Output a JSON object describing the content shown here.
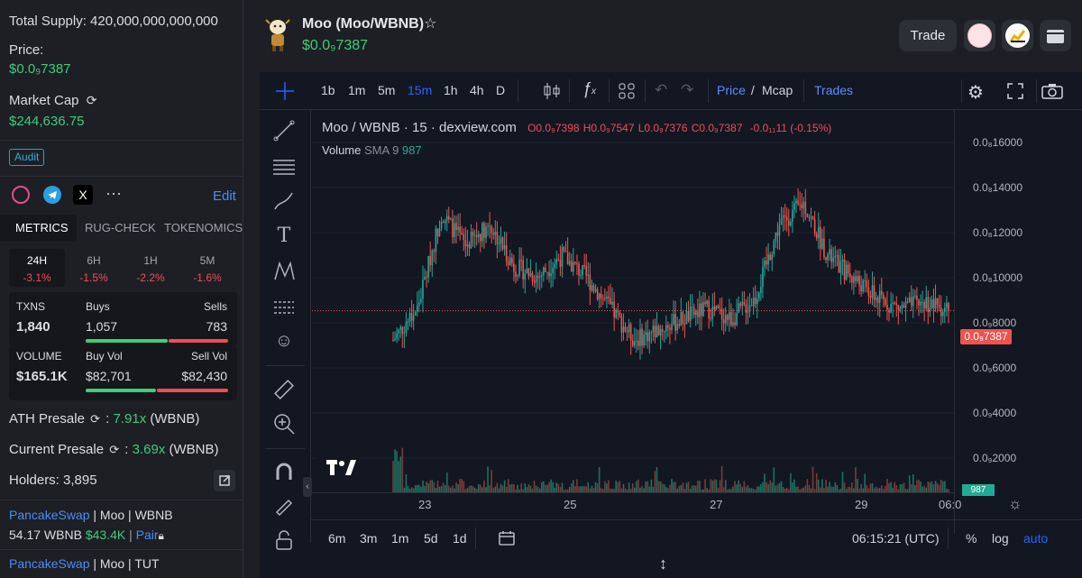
{
  "left": {
    "total_supply": "Total Supply: 420,000,000,000,000",
    "price_label": "Price:",
    "price_value": "$0.0₉7387",
    "mcap_label": "Market Cap",
    "mcap_value": "$244,636.75",
    "audit": "Audit",
    "edit": "Edit",
    "more": "···",
    "tabs": [
      "METRICS",
      "RUG-CHECK",
      "TOKENOMICS"
    ],
    "timeframes": [
      {
        "label": "24H",
        "change": "-3.1%"
      },
      {
        "label": "6H",
        "change": "-1.5%"
      },
      {
        "label": "1H",
        "change": "-2.2%"
      },
      {
        "label": "5M",
        "change": "-1.6%"
      }
    ],
    "txns": {
      "label": "TXNS",
      "value": "1,840",
      "buys_label": "Buys",
      "buys": "1,057",
      "sells_label": "Sells",
      "sells": "783"
    },
    "volume": {
      "label": "VOLUME",
      "value": "$165.1K",
      "buyvol_label": "Buy Vol",
      "buyvol": "$82,701",
      "sellvol_label": "Sell Vol",
      "sellvol": "$82,430"
    },
    "ath_label": "ATH Presale",
    "ath_sep": ":",
    "ath_value": "7.91x",
    "ath_unit": "(WBNB)",
    "cur_label": "Current Presale",
    "cur_sep": ":",
    "cur_value": "3.69x",
    "cur_unit": "(WBNB)",
    "holders": "Holders: 3,895",
    "pair1_dex": "PancakeSwap",
    "pair1_rest": " | Moo | WBNB",
    "pair1_amount": "54.17 WBNB",
    "pair1_usd": "$43.4K",
    "pair1_link": "Pair",
    "pair2_dex": "PancakeSwap",
    "pair2_rest": " | Moo | TUT"
  },
  "header": {
    "title": "Moo (Moo/WBNB)",
    "star": "☆",
    "price": "$0.0₉7387",
    "trade": "Trade"
  },
  "chart": {
    "intervals": [
      "1b",
      "1m",
      "5m",
      "15m",
      "1h",
      "4h",
      "D"
    ],
    "active_interval": "15m",
    "price_label": "Price",
    "slash": " / ",
    "mcap_label": "Mcap",
    "trades_label": "Trades",
    "legend_pair": "Moo / WBNB · 15 · dexview.com",
    "o": "O0.0₉7398",
    "h": "H0.0₉7547",
    "l": "L0.0₉7376",
    "c": "C0.0₉7387",
    "chg": "-0.0₁₁11 (-0.15%)",
    "vol_label": "Volume",
    "vol_sma": "SMA 9",
    "vol_value": "987",
    "y_ticks": [
      "0.0₈16000",
      "0.0₈14000",
      "0.0₈12000",
      "0.0₈10000",
      "0.0₉8000",
      "0.0₉6000",
      "0.0₉4000",
      "0.0₉2000"
    ],
    "last_price": "0.0₉7387",
    "vol_tag": "987",
    "x_ticks": [
      "23",
      "25",
      "27",
      "29",
      "06:0"
    ],
    "ranges": [
      "6m",
      "3m",
      "1m",
      "5d",
      "1d"
    ],
    "time": "06:15:21 (UTC)",
    "pct": "%",
    "log": "log",
    "auto": "auto"
  },
  "chart_data": {
    "type": "candlestick",
    "x_labels": [
      "23",
      "25",
      "27",
      "29"
    ],
    "y_range": [
      0,
      16500
    ],
    "y_unit": "0.0₉ (x1e-9 scale, tick labels as shown)",
    "approx_close_path": [
      6000,
      7500,
      12000,
      10500,
      11500,
      9500,
      9000,
      10000,
      9000,
      7500,
      6000,
      6500,
      7000,
      7500,
      7000,
      8000,
      11500,
      12500,
      10000,
      9000,
      8000,
      7500,
      7800,
      7387
    ],
    "last_close": 7387,
    "volume_last": 987
  }
}
